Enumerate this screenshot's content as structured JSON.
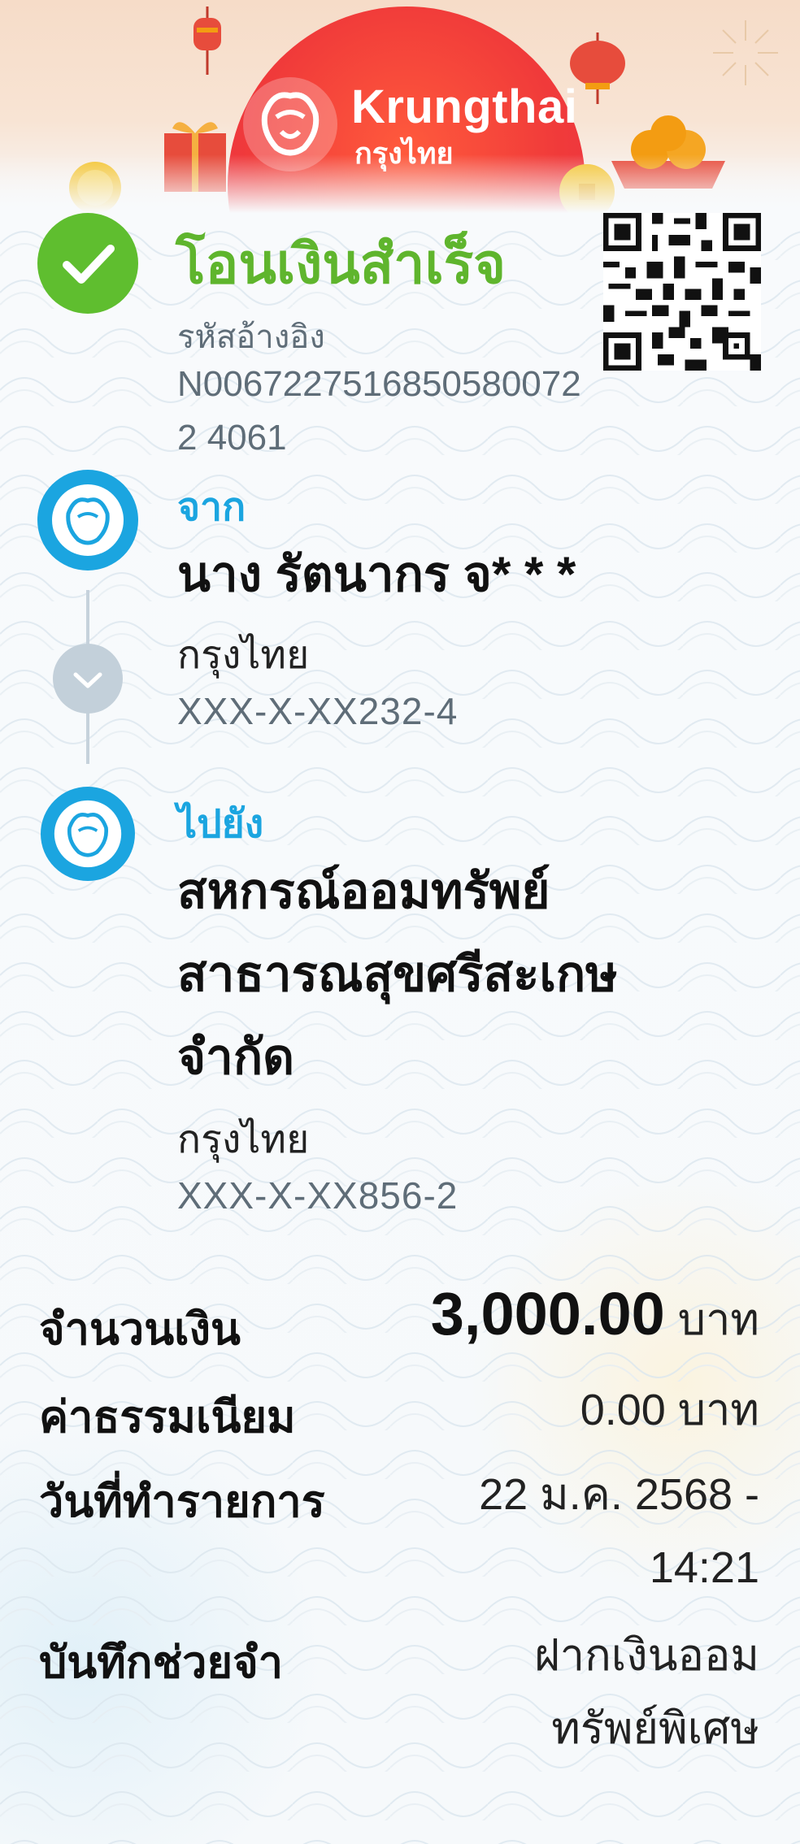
{
  "brand": {
    "name_en": "Krungthai",
    "name_th": "กรุงไทย",
    "colors": {
      "primary": "#1BA5E0",
      "success": "#5FB52D",
      "banner_red": "#F03A3A"
    }
  },
  "status": {
    "title": "โอนเงินสำเร็จ",
    "icon": "check-icon"
  },
  "reference": {
    "label": "รหัสอ้างอิง",
    "value": "N00672275168505800722 4061"
  },
  "from": {
    "label": "จาก",
    "name": "นาง รัตนากร จ* * *",
    "bank": "กรุงไทย",
    "account": "XXX-X-XX232-4"
  },
  "to": {
    "label": "ไปยัง",
    "name_line1": "สหกรณ์ออมทรัพย์",
    "name_line2": "สาธารณสุขศรีสะเกษ",
    "name_line3": "จำกัด",
    "bank": "กรุงไทย",
    "account": "XXX-X-XX856-2"
  },
  "details": {
    "amount_label": "จำนวนเงิน",
    "amount_value": "3,000.00",
    "amount_unit": "บาท",
    "fee_label": "ค่าธรรมเนียม",
    "fee_value": "0.00 บาท",
    "date_label": "วันที่ทำรายการ",
    "date_line1": "22 ม.ค. 2568 -",
    "date_line2": "14:21",
    "memo_label": "บันทึกช่วยจำ",
    "memo_line1": "ฝากเงินออม",
    "memo_line2": "ทรัพย์พิเศษ"
  }
}
